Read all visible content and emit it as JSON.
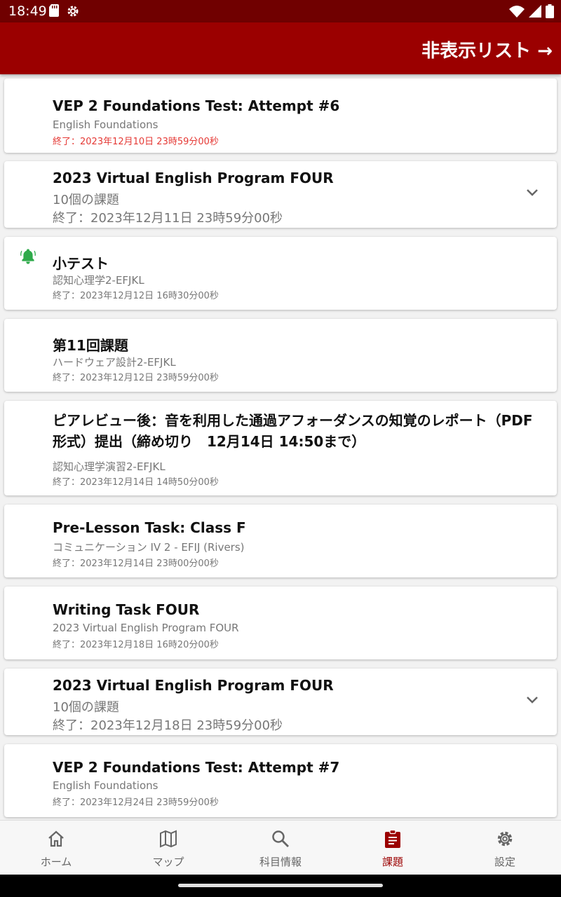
{
  "status_bar": {
    "time": "18:49",
    "icons": [
      "sd-card-icon",
      "settings-cog-icon",
      "wifi-icon",
      "cell-signal-icon",
      "battery-icon"
    ]
  },
  "app_bar": {
    "hidden_list_label": "非表示リスト →",
    "background_color": "#9b0000"
  },
  "assignments": [
    {
      "title": "VEP 2 Foundations Test: Attempt #6",
      "subject": "English Foundations",
      "due": "終了：2023年12月10日 23時59分00秒",
      "overdue": true
    },
    {
      "title": "2023 Virtual English Program FOUR",
      "subject": "10個の課題",
      "due": "終了：2023年12月11日 23時59分00秒",
      "group": true
    },
    {
      "title": "小テスト",
      "subject": "認知心理学2-EFJKL",
      "due": "終了：2023年12月12日 16時30分00秒",
      "alert": true
    },
    {
      "title": "第11回課題",
      "subject": "ハードウェア設計2-EFJKL",
      "due": "終了：2023年12月12日 23時59分00秒"
    },
    {
      "title": "ピアレビュー後：音を利用した通過アフォーダンスの知覚のレポート（PDF形式）提出（締め切り　12月14日 14:50まで）",
      "subject": "認知心理学演習2-EFJKL",
      "due": "終了：2023年12月14日 14時50分00秒"
    },
    {
      "title": "Pre-Lesson Task: Class F",
      "subject": "コミュニケーション IV 2 - EFIJ (Rivers)",
      "due": "終了：2023年12月14日 23時00分00秒"
    },
    {
      "title": "Writing Task FOUR",
      "subject": "2023 Virtual English Program FOUR",
      "due": "終了：2023年12月18日 16時20分00秒"
    },
    {
      "title": "2023 Virtual English Program FOUR",
      "subject": "10個の課題",
      "due": "終了：2023年12月18日 23時59分00秒",
      "group": true
    },
    {
      "title": "VEP 2 Foundations Test: Attempt #7",
      "subject": "English Foundations",
      "due": "終了：2023年12月24日 23時59分00秒"
    }
  ],
  "bottom_nav": [
    {
      "label": "ホーム",
      "icon": "home-icon"
    },
    {
      "label": "マップ",
      "icon": "map-icon"
    },
    {
      "label": "科目情報",
      "icon": "search-icon"
    },
    {
      "label": "課題",
      "icon": "clipboard-icon",
      "active": true
    },
    {
      "label": "設定",
      "icon": "gear-icon"
    }
  ],
  "colors": {
    "accent": "#9b0000",
    "overdue": "#e53935",
    "alert_bell": "#2eaa4a"
  }
}
